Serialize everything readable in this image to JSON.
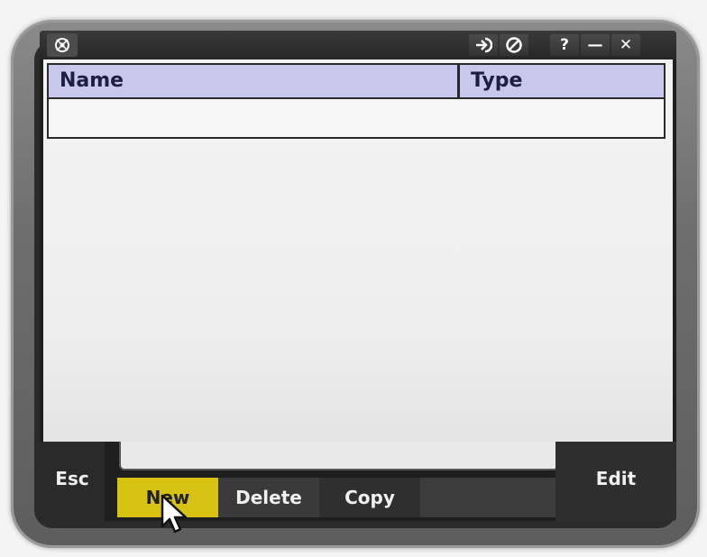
{
  "window": {
    "controls": {
      "login_icon": "arrow-in-icon",
      "cancel_icon": "no-entry-icon",
      "help_label": "?",
      "minimize_label": "—",
      "close_label": "✕"
    }
  },
  "table": {
    "columns": [
      "Name",
      "Type"
    ],
    "rows": []
  },
  "softkeys": {
    "esc": "Esc",
    "new": "New",
    "delete": "Delete",
    "copy": "Copy",
    "edit": "Edit"
  },
  "input": {
    "value": ""
  },
  "colors": {
    "header_bg": "#c9c8ec",
    "active_key": "#d7c112",
    "frame": "#6e6e6e"
  }
}
